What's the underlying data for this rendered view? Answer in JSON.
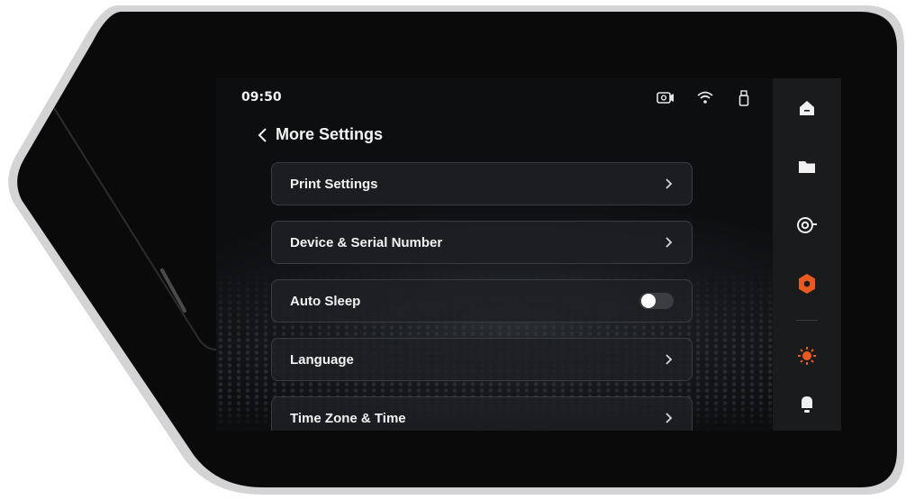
{
  "status_bar": {
    "time": "09:50",
    "icons": [
      "camera-icon",
      "wifi-icon",
      "usb-drive-icon"
    ]
  },
  "header": {
    "title": "More Settings"
  },
  "menu": {
    "items": [
      {
        "label": "Print Settings",
        "control": "chevron"
      },
      {
        "label": "Device & Serial Number",
        "control": "chevron"
      },
      {
        "label": "Auto Sleep",
        "control": "toggle",
        "toggle_on": false
      },
      {
        "label": "Language",
        "control": "chevron"
      },
      {
        "label": "Time Zone & Time",
        "control": "chevron"
      }
    ]
  },
  "sidebar": {
    "items": [
      {
        "icon": "home-icon",
        "active": false
      },
      {
        "icon": "folder-icon",
        "active": false
      },
      {
        "icon": "filament-spool-icon",
        "active": false
      },
      {
        "icon": "settings-hex-icon",
        "active": true
      },
      {
        "icon": "light-icon",
        "active": false
      },
      {
        "icon": "bell-icon",
        "active": false
      }
    ]
  },
  "colors": {
    "accent": "#e85a1f",
    "screen_bg": "#0d0e10",
    "sidebar_bg": "#1a1b1d"
  }
}
